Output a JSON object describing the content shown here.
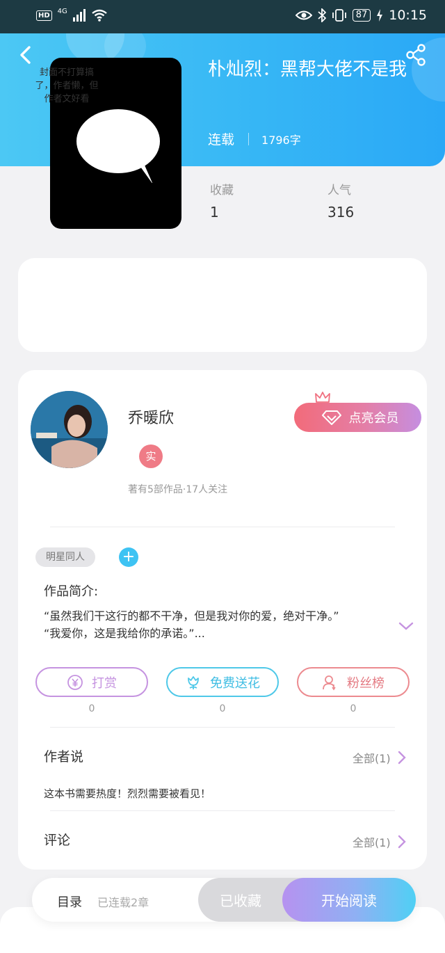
{
  "status_bar": {
    "hd": "HD",
    "network": "4G",
    "battery": "87",
    "time": "10:15"
  },
  "book": {
    "title": "朴灿烈：黑帮大佬不是我",
    "status": "连载",
    "word_count": "1796字",
    "cover_text": "封面不打算搞了，作者懒，但作者文好看",
    "collect_label": "收藏",
    "collect_value": "1",
    "popularity_label": "人气",
    "popularity_value": "316"
  },
  "author": {
    "name": "乔暖欣",
    "verified_badge": "实",
    "meta": "著有5部作品·17人关注",
    "member_button": "点亮会员"
  },
  "tags": {
    "items": [
      "明星同人"
    ],
    "add": "+"
  },
  "intro": {
    "heading": "作品简介:",
    "line1": "“虽然我们干这行的都不干净，但是我对你的爱，绝对干净。”",
    "line2": "“我爱你，这是我给你的承诺。”..."
  },
  "actions": {
    "reward": {
      "label": "打赏",
      "count": "0",
      "color": "#c593e0"
    },
    "flower": {
      "label": "免费送花",
      "count": "0",
      "color": "#4ec8e8"
    },
    "fans": {
      "label": "粉丝榜",
      "count": "0",
      "color": "#ec8a8f"
    }
  },
  "author_says": {
    "heading": "作者说",
    "all": "全部(1)",
    "text": "这本书需要热度！烈烈需要被看见！"
  },
  "comments": {
    "heading": "评论",
    "all": "全部(1)"
  },
  "bottom_bar": {
    "toc": "目录",
    "toc_sub": "已连载2章",
    "collected": "已收藏",
    "start_reading": "开始阅读"
  },
  "icons": [
    "back-icon",
    "share-icon",
    "eye-icon",
    "bluetooth-icon",
    "vibrate-icon",
    "battery-icon",
    "diamond-icon",
    "crown-icon",
    "yuan-icon",
    "flower-icon",
    "person-icon",
    "chevron-right-icon",
    "chevron-down-icon"
  ]
}
